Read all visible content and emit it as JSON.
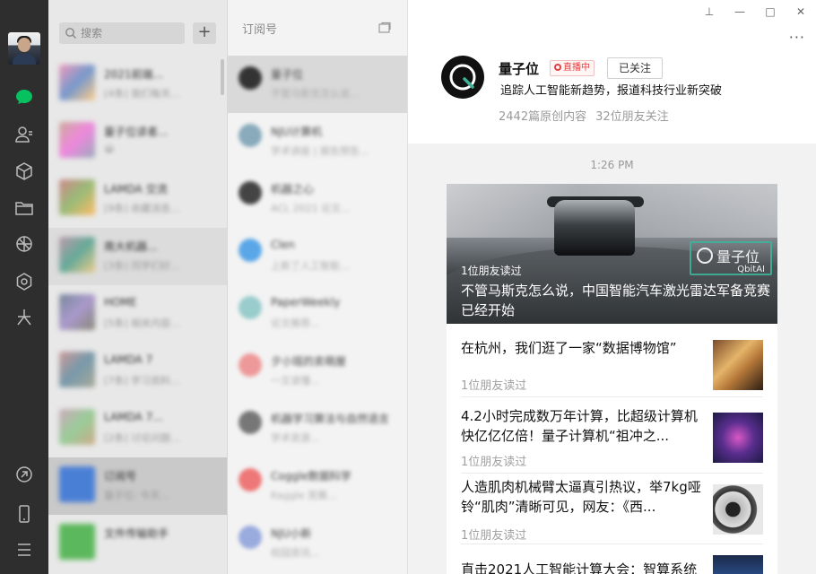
{
  "chat_list": {
    "search_placeholder": "搜索",
    "add_label": "+",
    "items": [
      {
        "name": "2021前端...",
        "preview": "[4条] 我们每天...",
        "time": ""
      },
      {
        "name": "量子位读者...",
        "preview": "😀",
        "time": ""
      },
      {
        "name": "LAMDA 交流",
        "preview": "[9条] 收藏消息...",
        "time": ""
      },
      {
        "name": "南大机器...",
        "preview": "[3条] 同学们好...",
        "time": ""
      },
      {
        "name": "HOME",
        "preview": "[5条] 相关内容...",
        "time": ""
      },
      {
        "name": "LAMDA 7",
        "preview": "[7条] 学习资料...",
        "time": ""
      },
      {
        "name": "LAMDA 7...",
        "preview": "[2条] 讨论问题...",
        "time": ""
      },
      {
        "name": "订阅号",
        "preview": "量子位: 今天...",
        "time": ""
      },
      {
        "name": "文件传输助手",
        "preview": "",
        "time": ""
      }
    ]
  },
  "subscriptions": {
    "title": "订阅号",
    "items": [
      {
        "name": "量子位",
        "preview": "不管马斯克怎么说...",
        "time": ""
      },
      {
        "name": "NJU计算机",
        "preview": "学术讲座 | 报告预告...",
        "time": ""
      },
      {
        "name": "机器之心",
        "preview": "ACL 2021 论文...",
        "time": ""
      },
      {
        "name": "Clen",
        "preview": "上新了人工智能...",
        "time": ""
      },
      {
        "name": "PaperWeekly",
        "preview": "论文推荐...",
        "time": ""
      },
      {
        "name": "夕小瑶的卖萌屋",
        "preview": "一文读懂...",
        "time": ""
      },
      {
        "name": "机器学习算法与自然语言",
        "preview": "学术资源...",
        "time": ""
      },
      {
        "name": "Coggle数据科学",
        "preview": "Kaggle 竞赛...",
        "time": ""
      },
      {
        "name": "NJU小新",
        "preview": "校园资讯...",
        "time": ""
      }
    ]
  },
  "window": {
    "pin": "⊥",
    "minimize": "—",
    "maximize": "□",
    "close": "✕",
    "more": "···"
  },
  "account": {
    "name": "量子位",
    "live_badge": "直播中",
    "follow_label": "已关注",
    "description": "追踪人工智能新趋势，报道科技行业新突破",
    "articles_count": "2442篇原创内容",
    "followers": "32位朋友关注"
  },
  "feed": {
    "time": "1:26 PM",
    "hero": {
      "friends_read": "1位朋友读过",
      "title": "不管马斯克怎么说，中国智能汽车激光雷达军备竞赛已经开始",
      "watermark_name": "量子位",
      "watermark_en": "QbitAI"
    },
    "articles": [
      {
        "title": "在杭州，我们逛了一家“数据博物馆”",
        "friends_read": "1位朋友读过"
      },
      {
        "title": "4.2小时完成数万年计算，比超级计算机快亿亿亿倍！量子计算机“祖冲之...",
        "friends_read": "1位朋友读过"
      },
      {
        "title": "人造肌肉机械臂太逼真引热议，举7kg哑铃“肌肉”清晰可见，网友：《西...",
        "friends_read": "1位朋友读过"
      },
      {
        "title": "直击2021人工智能计算大会：智算系统",
        "friends_read": ""
      }
    ]
  },
  "colors": {
    "nav_bg": "#2e2e2e",
    "accent": "#07c160",
    "live": "#e04040",
    "watermark": "#3fb39a"
  }
}
